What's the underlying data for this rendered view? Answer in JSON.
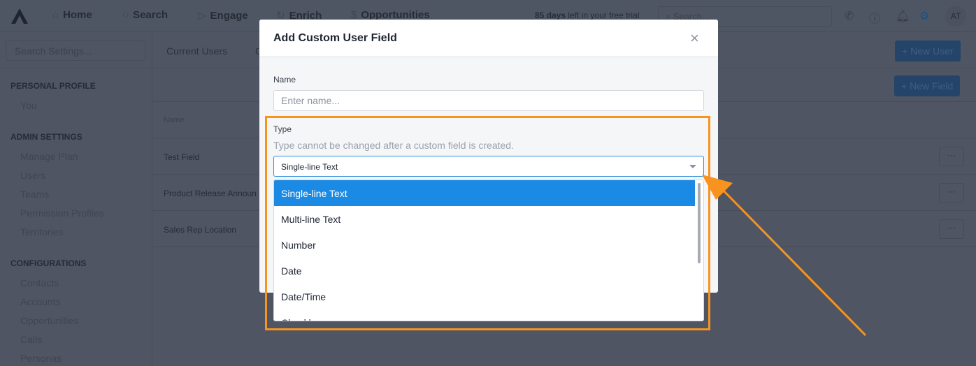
{
  "topnav": {
    "items": [
      {
        "label": "Home",
        "icon": "home-icon"
      },
      {
        "label": "Search",
        "icon": "search-icon"
      },
      {
        "label": "Engage",
        "icon": "send-icon"
      },
      {
        "label": "Enrich",
        "icon": "refresh-icon"
      },
      {
        "label": "Opportunities",
        "icon": "dollar-icon"
      }
    ],
    "trial_bold": "85 days",
    "trial_rest": " left in your free trial",
    "search_placeholder": "Search...",
    "avatar": "AT"
  },
  "sidebar": {
    "search_placeholder": "Search Settings...",
    "sections": [
      {
        "title": "PERSONAL PROFILE",
        "items": [
          "You"
        ]
      },
      {
        "title": "ADMIN SETTINGS",
        "items": [
          "Manage Plan",
          "Users",
          "Teams",
          "Permission Profiles",
          "Territories"
        ]
      },
      {
        "title": "CONFIGURATIONS",
        "items": [
          "Contacts",
          "Accounts",
          "Opportunities",
          "Calls",
          "Personas"
        ]
      }
    ]
  },
  "main": {
    "tabs": [
      "Current Users",
      "C"
    ],
    "new_user": "New User",
    "new_field": "New Field",
    "column_name": "Name",
    "rows": [
      "Test Field",
      "Product Release Announ",
      "Sales Rep Location"
    ],
    "more": "···"
  },
  "modal": {
    "title": "Add Custom User Field",
    "close": "×",
    "name_label": "Name",
    "name_placeholder": "Enter name...",
    "type_label": "Type",
    "type_help": "Type cannot be changed after a custom field is created.",
    "type_value": "Single-line Text",
    "options": [
      "Single-line Text",
      "Multi-line Text",
      "Number",
      "Date",
      "Date/Time",
      "Checkbox"
    ]
  },
  "colors": {
    "highlight": "#f7931e",
    "accent": "#1a8ae4"
  }
}
